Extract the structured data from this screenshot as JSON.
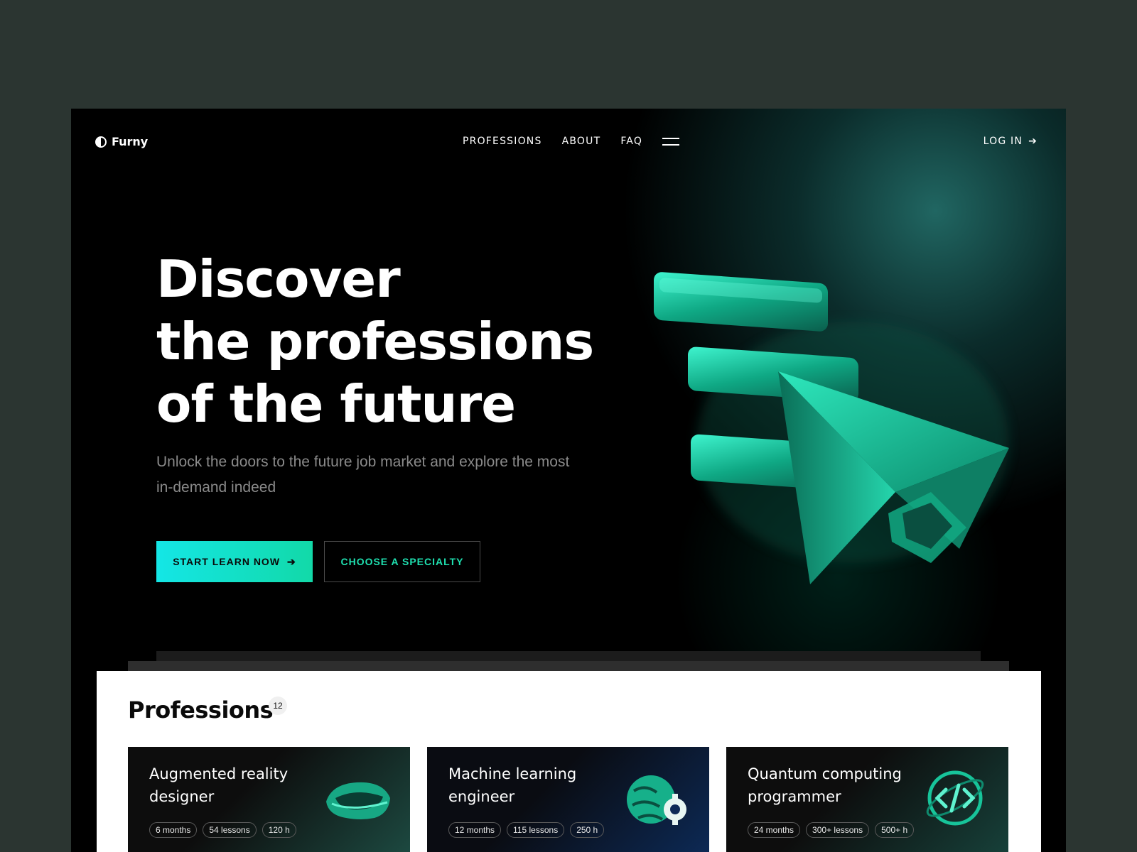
{
  "brand": {
    "name": "Furny"
  },
  "nav": {
    "links": [
      "PROFESSIONS",
      "ABOUT",
      "FAQ"
    ],
    "login": "LOG IN"
  },
  "hero": {
    "title_lines": [
      "Discover",
      "the professions",
      "of the future"
    ],
    "subtitle": "Unlock the doors to the future job market and explore the most in-demand indeed",
    "primary_button": "START LEARN NOW",
    "secondary_button": "CHOOSE A SPECIALTY"
  },
  "professions": {
    "title": "Professions",
    "count": "12",
    "cards": [
      {
        "title": "Augmented reality designer",
        "tags": [
          "6 months",
          "54 lessons",
          "120 h"
        ],
        "icon": "vr-headset-icon"
      },
      {
        "title": "Machine learning engineer",
        "tags": [
          "12 months",
          "115 lessons",
          "250 h"
        ],
        "icon": "brain-gear-icon"
      },
      {
        "title": "Quantum computing programmer",
        "tags": [
          "24 months",
          "300+ lessons",
          "500+ h"
        ],
        "icon": "code-orb-icon"
      }
    ]
  },
  "colors": {
    "accent": "#14e6c0",
    "background": "#000000",
    "outer": "#2b3531"
  }
}
